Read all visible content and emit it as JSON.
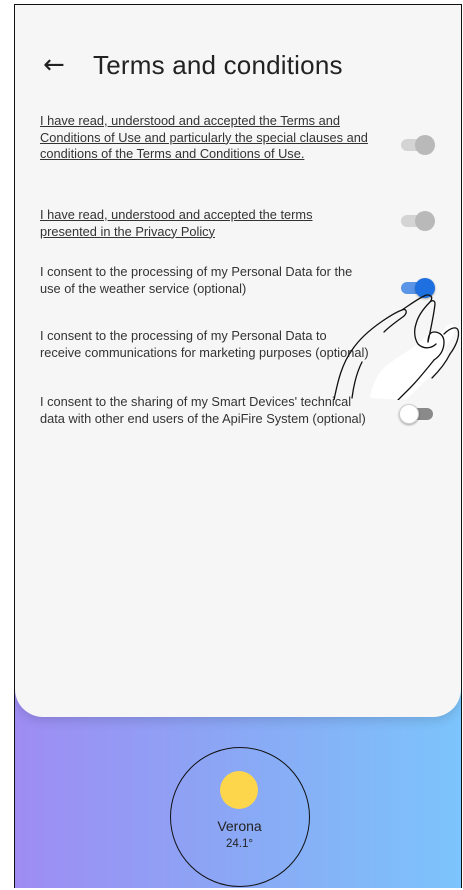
{
  "header": {
    "back_icon": "arrow-left-icon",
    "back_glyph": "←",
    "title": "Terms and conditions"
  },
  "consents": [
    {
      "text": "I have read, understood and accepted the Terms and Conditions of Use and particularly the special clauses and conditions of the Terms and Conditions of Use.",
      "state": "on-disabled"
    },
    {
      "text": "I have read, understood and accepted the terms presented in the Privacy Policy",
      "state": "on-disabled"
    },
    {
      "text": "I consent to the processing of my Personal Data for the use of the weather service (optional)",
      "state": "on"
    },
    {
      "text": "I consent to the processing of my Personal Data to receive communications for marketing purposes (optional)",
      "state": "off"
    },
    {
      "text": "I consent to the sharing of my Smart Devices' technical data with other end users of the ApiFire System (optional)",
      "state": "off"
    }
  ],
  "weather": {
    "icon": "sun-icon",
    "city": "Verona",
    "temperature": "24.1°"
  },
  "colors": {
    "accent": "#1e6fe0",
    "sun": "#fdd64c",
    "gradient_start": "#9e8cf3",
    "gradient_end": "#7cc4fb"
  }
}
